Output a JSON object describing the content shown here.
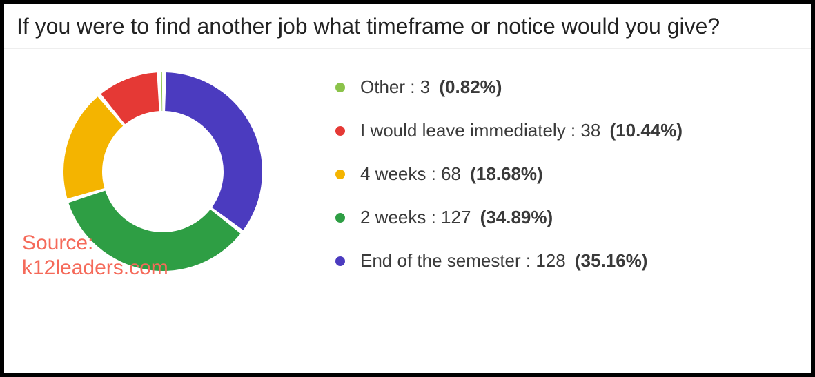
{
  "title": "If you were to find another job what timeframe or notice would you give?",
  "source_prefix": "Source:",
  "source_name": "k12leaders.com",
  "chart_data": {
    "type": "pie",
    "title": "If you were to find another job what timeframe or notice would you give?",
    "series": [
      {
        "name": "Other",
        "value": 3,
        "percent": "0.82%",
        "color": "#8bc34a"
      },
      {
        "name": "I would leave immediately",
        "value": 38,
        "percent": "10.44%",
        "color": "#e53935"
      },
      {
        "name": "4 weeks",
        "value": 68,
        "percent": "18.68%",
        "color": "#f4b400"
      },
      {
        "name": "2 weeks",
        "value": 127,
        "percent": "34.89%",
        "color": "#2e9e44"
      },
      {
        "name": "End of the semester",
        "value": 128,
        "percent": "35.16%",
        "color": "#4b3bbf"
      }
    ]
  }
}
